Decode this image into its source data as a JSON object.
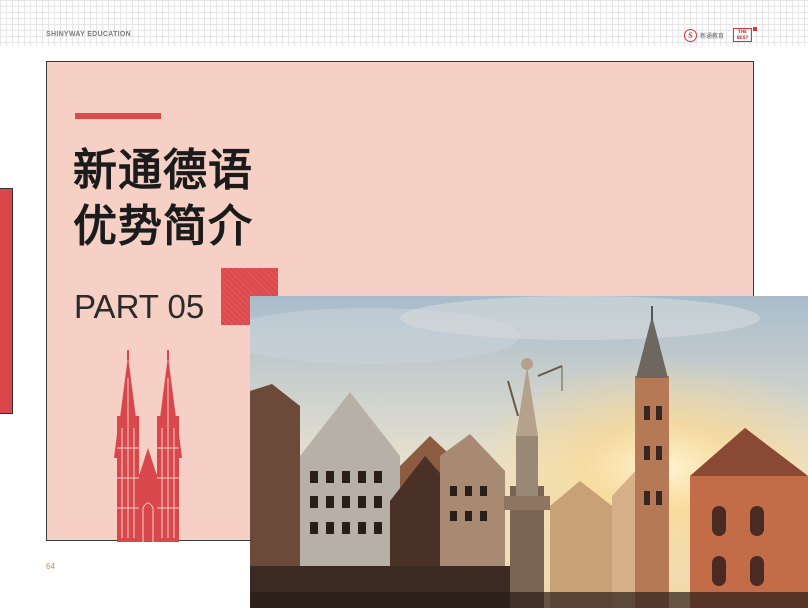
{
  "header": {
    "brand": "SHINYWAY EDUCATION",
    "logo_mark": "S",
    "logo_text": "新通教育",
    "stamp_text": "THE BEST"
  },
  "section": {
    "title_line1": "新通德语",
    "title_line2": "优势简介",
    "part_label": "PART 05"
  },
  "page_number": "64",
  "colors": {
    "accent_red": "#db4a4d",
    "panel_pink": "#f6cfc5",
    "title_dark": "#1b1b1b"
  },
  "icons": {
    "cathedral": "cologne-cathedral-icon",
    "photo": "frankfurt-romerberg-photo"
  }
}
